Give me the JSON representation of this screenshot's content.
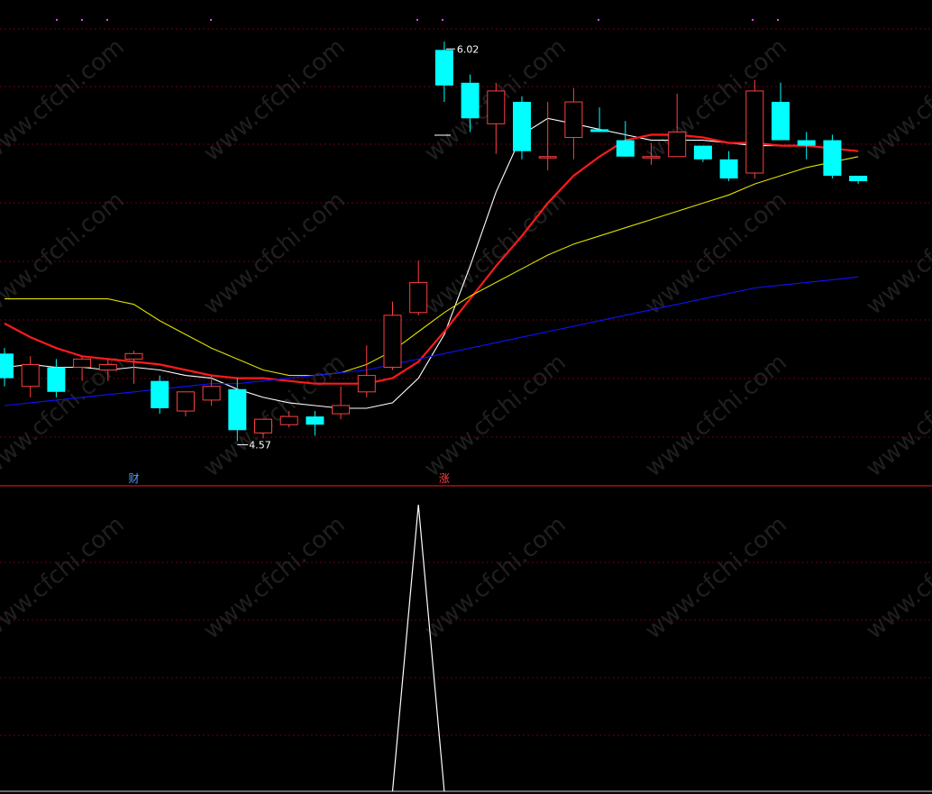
{
  "chart_data": [
    {
      "type": "candlestick",
      "panel": "main",
      "ylim": [
        4.4,
        6.1
      ],
      "grid": true,
      "price_high_label": "6.02",
      "price_low_label": "4.57",
      "markers": [
        {
          "text": "财",
          "index": 5,
          "color": "#4aa0ff"
        },
        {
          "text": "涨",
          "index": 17,
          "color": "#ff4040"
        }
      ],
      "candles": [
        {
          "o": 4.88,
          "h": 4.9,
          "l": 4.76,
          "c": 4.79
        },
        {
          "o": 4.76,
          "h": 4.87,
          "l": 4.72,
          "c": 4.84
        },
        {
          "o": 4.83,
          "h": 4.86,
          "l": 4.72,
          "c": 4.74
        },
        {
          "o": 4.83,
          "h": 4.87,
          "l": 4.78,
          "c": 4.86
        },
        {
          "o": 4.82,
          "h": 4.86,
          "l": 4.78,
          "c": 4.84
        },
        {
          "o": 4.86,
          "h": 4.89,
          "l": 4.77,
          "c": 4.88
        },
        {
          "o": 4.78,
          "h": 4.8,
          "l": 4.66,
          "c": 4.68
        },
        {
          "o": 4.67,
          "h": 4.74,
          "l": 4.65,
          "c": 4.74
        },
        {
          "o": 4.71,
          "h": 4.8,
          "l": 4.69,
          "c": 4.76
        },
        {
          "o": 4.75,
          "h": 4.79,
          "l": 4.56,
          "c": 4.6
        },
        {
          "o": 4.59,
          "h": 4.64,
          "l": 4.57,
          "c": 4.64
        },
        {
          "o": 4.62,
          "h": 4.67,
          "l": 4.61,
          "c": 4.65
        },
        {
          "o": 4.65,
          "h": 4.67,
          "l": 4.58,
          "c": 4.62
        },
        {
          "o": 4.66,
          "h": 4.76,
          "l": 4.64,
          "c": 4.69
        },
        {
          "o": 4.74,
          "h": 4.91,
          "l": 4.72,
          "c": 4.8
        },
        {
          "o": 4.83,
          "h": 5.07,
          "l": 4.82,
          "c": 5.02
        },
        {
          "o": 5.03,
          "h": 5.22,
          "l": 5.02,
          "c": 5.14
        },
        {
          "o": 5.99,
          "h": 6.02,
          "l": 5.8,
          "c": 5.86
        },
        {
          "o": 5.87,
          "h": 5.9,
          "l": 5.69,
          "c": 5.74
        },
        {
          "o": 5.72,
          "h": 5.87,
          "l": 5.61,
          "c": 5.84
        },
        {
          "o": 5.8,
          "h": 5.82,
          "l": 5.59,
          "c": 5.62
        },
        {
          "o": 5.6,
          "h": 5.8,
          "l": 5.55,
          "c": 5.6
        },
        {
          "o": 5.67,
          "h": 5.85,
          "l": 5.59,
          "c": 5.8
        },
        {
          "o": 5.7,
          "h": 5.78,
          "l": 5.69,
          "c": 5.69
        },
        {
          "o": 5.66,
          "h": 5.73,
          "l": 5.6,
          "c": 5.6
        },
        {
          "o": 5.6,
          "h": 5.65,
          "l": 5.57,
          "c": 5.6
        },
        {
          "o": 5.6,
          "h": 5.83,
          "l": 5.6,
          "c": 5.69
        },
        {
          "o": 5.64,
          "h": 5.64,
          "l": 5.58,
          "c": 5.59
        },
        {
          "o": 5.59,
          "h": 5.62,
          "l": 5.51,
          "c": 5.52
        },
        {
          "o": 5.54,
          "h": 5.88,
          "l": 5.52,
          "c": 5.84
        },
        {
          "o": 5.8,
          "h": 5.87,
          "l": 5.66,
          "c": 5.66
        },
        {
          "o": 5.66,
          "h": 5.69,
          "l": 5.59,
          "c": 5.64
        },
        {
          "o": 5.66,
          "h": 5.68,
          "l": 5.52,
          "c": 5.53
        },
        {
          "o": 5.53,
          "h": 5.53,
          "l": 5.5,
          "c": 5.51
        }
      ],
      "ma_lines": [
        {
          "color": "#ffffff",
          "values": [
            4.83,
            4.84,
            4.83,
            4.83,
            4.82,
            4.83,
            4.82,
            4.8,
            4.79,
            4.75,
            4.72,
            4.7,
            4.69,
            4.68,
            4.68,
            4.7,
            4.79,
            4.95,
            5.2,
            5.47,
            5.68,
            5.74,
            5.72,
            5.7,
            5.68,
            5.66,
            5.66,
            5.66,
            5.65,
            5.64,
            5.64,
            5.64,
            5.63,
            5.62
          ]
        },
        {
          "color": "#ff1a1a",
          "values": [
            4.99,
            4.94,
            4.9,
            4.87,
            4.86,
            4.85,
            4.84,
            4.82,
            4.8,
            4.79,
            4.79,
            4.78,
            4.77,
            4.77,
            4.77,
            4.79,
            4.85,
            4.96,
            5.08,
            5.2,
            5.31,
            5.43,
            5.53,
            5.6,
            5.66,
            5.68,
            5.68,
            5.67,
            5.65,
            5.65,
            5.64,
            5.64,
            5.63,
            5.62
          ]
        },
        {
          "color": "#e0e000",
          "values": [
            5.08,
            5.08,
            5.08,
            5.08,
            5.08,
            5.06,
            5.0,
            4.95,
            4.9,
            4.86,
            4.82,
            4.8,
            4.8,
            4.81,
            4.84,
            4.89,
            4.96,
            5.03,
            5.09,
            5.14,
            5.19,
            5.24,
            5.28,
            5.31,
            5.34,
            5.37,
            5.4,
            5.43,
            5.46,
            5.5,
            5.53,
            5.56,
            5.58,
            5.6
          ]
        },
        {
          "color": "#1010ff",
          "values": [
            4.69,
            4.7,
            4.71,
            4.72,
            4.73,
            4.74,
            4.75,
            4.76,
            4.77,
            4.77,
            4.78,
            4.79,
            4.8,
            4.81,
            4.82,
            4.84,
            4.86,
            4.88,
            4.9,
            4.92,
            4.94,
            4.96,
            4.98,
            5.0,
            5.02,
            5.04,
            5.06,
            5.08,
            5.1,
            5.12,
            5.13,
            5.14,
            5.15,
            5.16
          ]
        }
      ]
    },
    {
      "type": "line",
      "panel": "indicator",
      "ylim": [
        0,
        1
      ],
      "grid": true,
      "color": "#ffffff",
      "values": [
        0,
        0,
        0,
        0,
        0,
        0,
        0,
        0,
        0,
        0,
        0,
        0,
        0,
        0,
        0,
        0,
        1,
        0,
        0,
        0,
        0,
        0,
        0,
        0,
        0,
        0,
        0,
        0,
        0,
        0,
        0,
        0,
        0,
        0
      ]
    }
  ],
  "watermark": "www.cfchi.com",
  "colors": {
    "up": "#ff4040",
    "down": "#00ffff",
    "grid": "#6a0010",
    "divider": "#c01818",
    "dots": "#ff40ff"
  }
}
